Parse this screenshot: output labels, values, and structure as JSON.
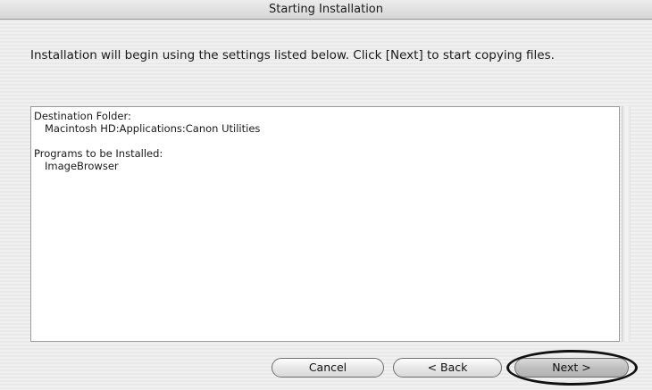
{
  "window": {
    "title": "Starting Installation"
  },
  "instruction": "Installation will begin using the settings listed below. Click [Next] to start copying files.",
  "summary": {
    "destination_label": "Destination Folder:",
    "destination_value": "Macintosh HD:Applications:Canon Utilities",
    "programs_label": "Programs to be Installed:",
    "programs_value": "ImageBrowser"
  },
  "buttons": {
    "cancel": "Cancel",
    "back": "< Back",
    "next": "Next >"
  }
}
